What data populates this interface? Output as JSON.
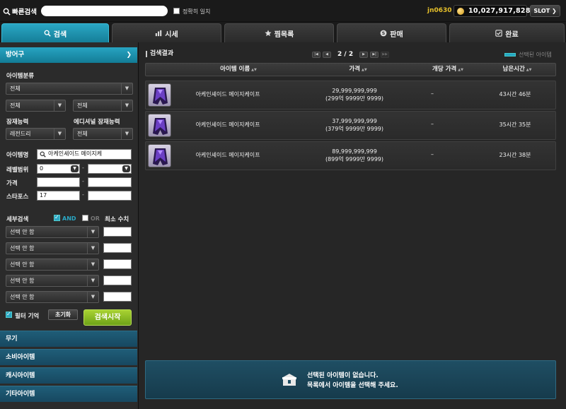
{
  "topbar": {
    "quick_search_label": "빠른검색",
    "search_value": "",
    "exact_match_label": "정확히 일치",
    "user": "jn0630",
    "meso": "10,027,917,828",
    "slot_label": "SLOT"
  },
  "tabs": [
    {
      "label": "검색",
      "icon": "search-icon",
      "active": true
    },
    {
      "label": "시세",
      "icon": "bar-chart-icon",
      "active": false
    },
    {
      "label": "찜목록",
      "icon": "star-icon",
      "active": false
    },
    {
      "label": "판매",
      "icon": "coin-s-icon",
      "active": false
    },
    {
      "label": "완료",
      "icon": "check-box-icon",
      "active": false
    }
  ],
  "filter": {
    "category_header": "방어구",
    "item_class_label": "아이템분류",
    "item_class_value": "전체",
    "sub1_value": "전체",
    "sub2_value": "전체",
    "potential_label": "잠재능력",
    "potential_value": "레전드리",
    "additional_label": "에디셔널 잠재능력",
    "additional_value": "전체",
    "item_name_label": "아이템명",
    "item_name_value": "아케인셰이드 메이지케",
    "level_label": "레벨범위",
    "level_min": "0",
    "level_max": "",
    "price_label": "가격",
    "price_min": "",
    "price_max": "",
    "starforce_label": "스타포스",
    "starforce_min": "17",
    "starforce_max": "",
    "detail_label": "세부검색",
    "and_label": "AND",
    "or_label": "OR",
    "min_value_label": "최소 수치",
    "option_rows": [
      {
        "value": "선택 안 함",
        "min": ""
      },
      {
        "value": "선택 안 함",
        "min": ""
      },
      {
        "value": "선택 안 함",
        "min": ""
      },
      {
        "value": "선택 안 함",
        "min": ""
      },
      {
        "value": "선택 안 함",
        "min": ""
      }
    ],
    "remember_label": "필터 기억",
    "reset_label": "초기화",
    "search_label": "검색시작"
  },
  "categories": [
    "무기",
    "소비아이템",
    "캐시아이템",
    "기타아이템"
  ],
  "results": {
    "title": "검색결과",
    "page": "2 / 2",
    "legend": "선택된 아이템",
    "columns": [
      "아이템 이름",
      "가격",
      "개당 가격",
      "남은시간"
    ],
    "rows": [
      {
        "name": "아케인셰이드 메이지케이프",
        "price": "29,999,999,999",
        "price_sub": "(299억 9999만 9999)",
        "unit": "–",
        "time": "43시간 46분"
      },
      {
        "name": "아케인셰이드 메이지케이프",
        "price": "37,999,999,999",
        "price_sub": "(379억 9999만 9999)",
        "unit": "–",
        "time": "35시간 35분"
      },
      {
        "name": "아케인셰이드 메이지케이프",
        "price": "89,999,999,999",
        "price_sub": "(899억 9999만 9999)",
        "unit": "–",
        "time": "23시간 38분"
      }
    ],
    "empty_line1": "선택된 아이템이 없습니다.",
    "empty_line2": "목록에서 아이템을 선택해 주세요."
  },
  "colors": {
    "accent": "#2aa7c4",
    "meso": "#e6c02a",
    "go_button": "#8cc026"
  }
}
